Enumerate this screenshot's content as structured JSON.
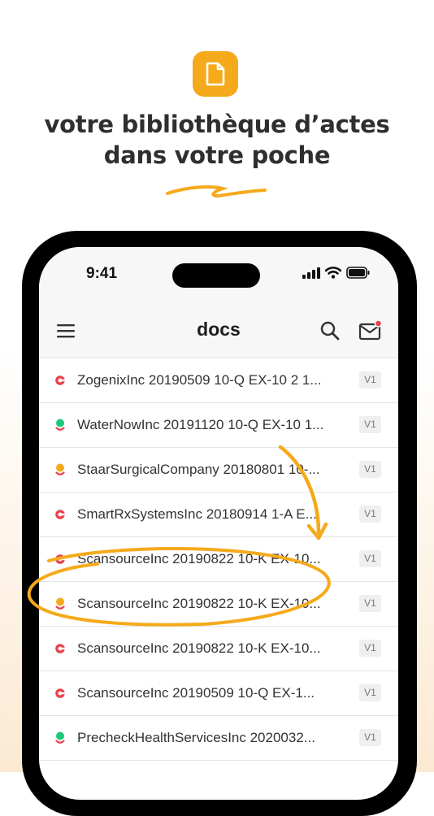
{
  "promo": {
    "headline_line1": "votre bibliothèque d’actes",
    "headline_line2": "dans votre poche",
    "icon": "document-icon",
    "accent_color": "#f5aa1c"
  },
  "status_bar": {
    "time": "9:41",
    "icons": [
      "signal-icon",
      "wifi-icon",
      "battery-icon"
    ]
  },
  "nav": {
    "title": "docs",
    "menu_icon": "hamburger-menu-icon",
    "search_icon": "search-icon",
    "mail_icon": "mail-icon",
    "mail_has_notification": true
  },
  "status_colors": {
    "red": "#e8434b",
    "green": "#1ec87a",
    "orange": "#f5aa1c"
  },
  "documents": [
    {
      "name": "ZogenixInc 20190509 10-Q EX-10 2 1...",
      "version": "V1",
      "status": "red"
    },
    {
      "name": "WaterNowInc 20191120 10-Q EX-10 1...",
      "version": "V1",
      "status": "green"
    },
    {
      "name": "StaarSurgicalCompany 20180801 10-...",
      "version": "V1",
      "status": "orange"
    },
    {
      "name": "SmartRxSystemsInc 20180914 1-A E...",
      "version": "V1",
      "status": "red"
    },
    {
      "name": "ScansourceInc 20190822 10-K EX-10...",
      "version": "V1",
      "status": "red"
    },
    {
      "name": "ScansourceInc 20190822 10-K EX-10...",
      "version": "V1",
      "status": "orange"
    },
    {
      "name": "ScansourceInc 20190822 10-K EX-10...",
      "version": "V1",
      "status": "red"
    },
    {
      "name": "ScansourceInc 20190509 10-Q EX-1...",
      "version": "V1",
      "status": "red"
    },
    {
      "name": "PrecheckHealthServicesInc 2020032...",
      "version": "V1",
      "status": "green"
    }
  ]
}
